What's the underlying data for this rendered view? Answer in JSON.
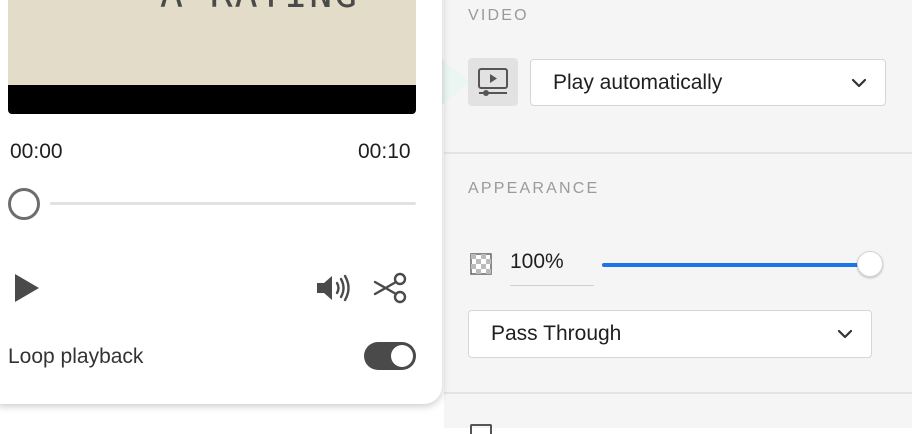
{
  "player": {
    "video_caption": "A RATING",
    "time_current": "00:00",
    "time_total": "00:10",
    "progress": 0,
    "loop_label": "Loop playback",
    "loop_enabled": true,
    "icons": [
      "play-icon",
      "volume-icon",
      "scissors-icon"
    ]
  },
  "inspector": {
    "video": {
      "title": "VIDEO",
      "icon": "video-player-icon",
      "playback_select": "Play automatically"
    },
    "appearance": {
      "title": "APPEARANCE",
      "opacity_icon": "transparency-checker-icon",
      "opacity_value": "100%",
      "opacity_level": 1.0,
      "blend_mode_select": "Pass Through"
    }
  },
  "colors": {
    "accent": "#1d74e8",
    "panel_bg": "#f5f5f5",
    "toggle_on": "#4a4a4a"
  }
}
